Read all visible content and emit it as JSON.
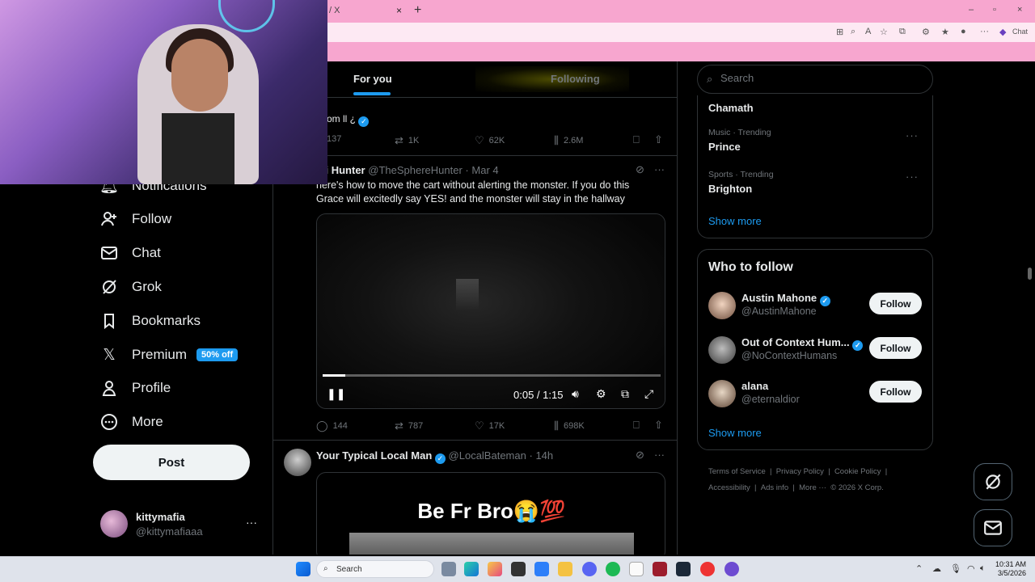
{
  "browser": {
    "tab_title": "/ X",
    "tab_close": "×",
    "new_tab": "+",
    "window_controls": [
      "–",
      "▫",
      "×"
    ],
    "copilot_label": "Chat"
  },
  "nav": {
    "items": [
      {
        "label": "Notifications",
        "icon": "bell-icon"
      },
      {
        "label": "Follow",
        "icon": "add-person-icon"
      },
      {
        "label": "Chat",
        "icon": "mail-icon"
      },
      {
        "label": "Grok",
        "icon": "grok-icon"
      },
      {
        "label": "Bookmarks",
        "icon": "bookmark-icon"
      },
      {
        "label": "Premium",
        "icon": "x-logo-icon",
        "badge": "50% off"
      },
      {
        "label": "Profile",
        "icon": "person-icon"
      },
      {
        "label": "More",
        "icon": "more-circle-icon"
      }
    ],
    "post_button": "Post",
    "account": {
      "name": "kittymafia",
      "handle": "@kittymafiaaa",
      "more": "···"
    }
  },
  "feed": {
    "tabs": {
      "for_you": "For you",
      "following": "Following"
    },
    "prev_tweet": {
      "partial_text": "om ll ¿",
      "stats": {
        "replies": "137",
        "reposts": "1K",
        "likes": "62K",
        "views": "2.6M"
      }
    },
    "tweet1": {
      "name": "zi Hunter",
      "handle": "@TheSphereHunter",
      "sep": "·",
      "time": "Mar 4",
      "more": "···",
      "text": "here's how to move the cart without alerting the monster. If you do this Grace will excitedly say YES! and the monster will stay in the hallway",
      "video": {
        "time": "0:05 / 1:15",
        "progress": 0.066
      },
      "stats": {
        "replies": "144",
        "reposts": "787",
        "likes": "17K",
        "views": "698K"
      }
    },
    "tweet2": {
      "name": "Your Typical Local Man",
      "handle": "@LocalBateman",
      "sep": "·",
      "time": "14h",
      "more": "···",
      "media_caption": "Be Fr Bro😭💯"
    }
  },
  "right": {
    "search_placeholder": "Search",
    "trending": [
      {
        "category": "",
        "name": "Chamath"
      },
      {
        "category": "Music · Trending",
        "name": "Prince"
      },
      {
        "category": "Sports · Trending",
        "name": "Brighton"
      }
    ],
    "trend_more": "···",
    "show_more": "Show more",
    "who_to_follow": {
      "title": "Who to follow",
      "people": [
        {
          "name": "Austin Mahone",
          "handle": "@AustinMahone",
          "verified": true,
          "button": "Follow"
        },
        {
          "name": "Out of Context Hum...",
          "handle": "@NoContextHumans",
          "verified": true,
          "button": "Follow"
        },
        {
          "name": "alana",
          "handle": "@eternaldior",
          "verified": false,
          "button": "Follow"
        }
      ],
      "show_more": "Show more"
    },
    "footer": [
      "Terms of Service",
      "|",
      "Privacy Policy",
      "|",
      "Cookie Policy",
      "|",
      "Accessibility",
      "|",
      "Ads info",
      "|",
      "More ···",
      "© 2026 X Corp."
    ]
  },
  "taskbar": {
    "search": "Search",
    "time": "10:31 AM",
    "date": "3/5/2026"
  },
  "colors": {
    "accent": "#1d9bf0",
    "browser_pink": "#f7a6cf",
    "background": "#000000"
  }
}
